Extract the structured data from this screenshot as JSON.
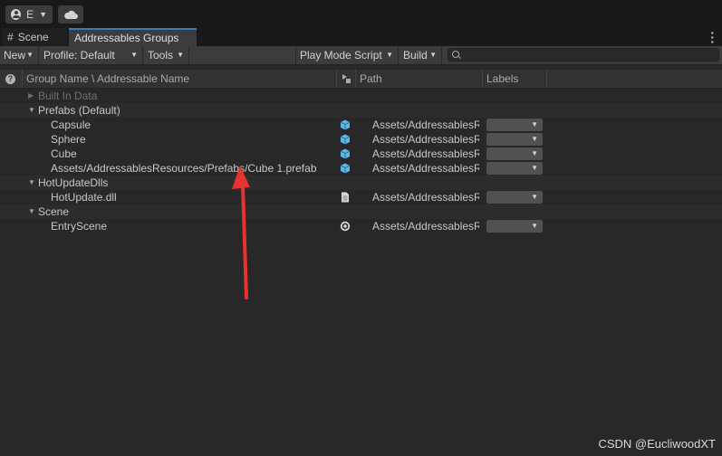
{
  "topbar": {
    "account_label": "E"
  },
  "tabs": {
    "scene": "Scene",
    "active": "Addressables Groups"
  },
  "toolbar": {
    "new": "New",
    "profile": "Profile: Default",
    "tools": "Tools",
    "play_mode": "Play Mode Script",
    "build": "Build",
    "search_value": ""
  },
  "columns": {
    "name": "Group Name \\ Addressable Name",
    "path": "Path",
    "labels": "Labels"
  },
  "groups": {
    "built_in": {
      "name": "Built In Data"
    },
    "prefabs": {
      "name": "Prefabs (Default)",
      "entries": [
        {
          "name": "Capsule",
          "path": "Assets/AddressablesR",
          "icon": "prefab-cube-icon"
        },
        {
          "name": "Sphere",
          "path": "Assets/AddressablesR",
          "icon": "prefab-cube-icon"
        },
        {
          "name": "Cube",
          "path": "Assets/AddressablesR",
          "icon": "prefab-cube-icon"
        },
        {
          "name": "Assets/AddressablesResources/Prefabs/Cube 1.prefab",
          "path": "Assets/AddressablesR",
          "icon": "prefab-cube-icon"
        }
      ]
    },
    "hotupdate": {
      "name": "HotUpdateDlls",
      "entries": [
        {
          "name": "HotUpdate.dll",
          "path": "Assets/AddressablesR",
          "icon": "document-icon"
        }
      ]
    },
    "scene": {
      "name": "Scene",
      "entries": [
        {
          "name": "EntryScene",
          "path": "Assets/AddressablesR",
          "icon": "unity-scene-icon"
        }
      ]
    }
  },
  "colors": {
    "accent_tab": "#3a79bb",
    "prefab_icon": "#5fb8ea",
    "annotation_arrow": "#e8322f"
  },
  "watermark": "CSDN @EucliwoodXT"
}
